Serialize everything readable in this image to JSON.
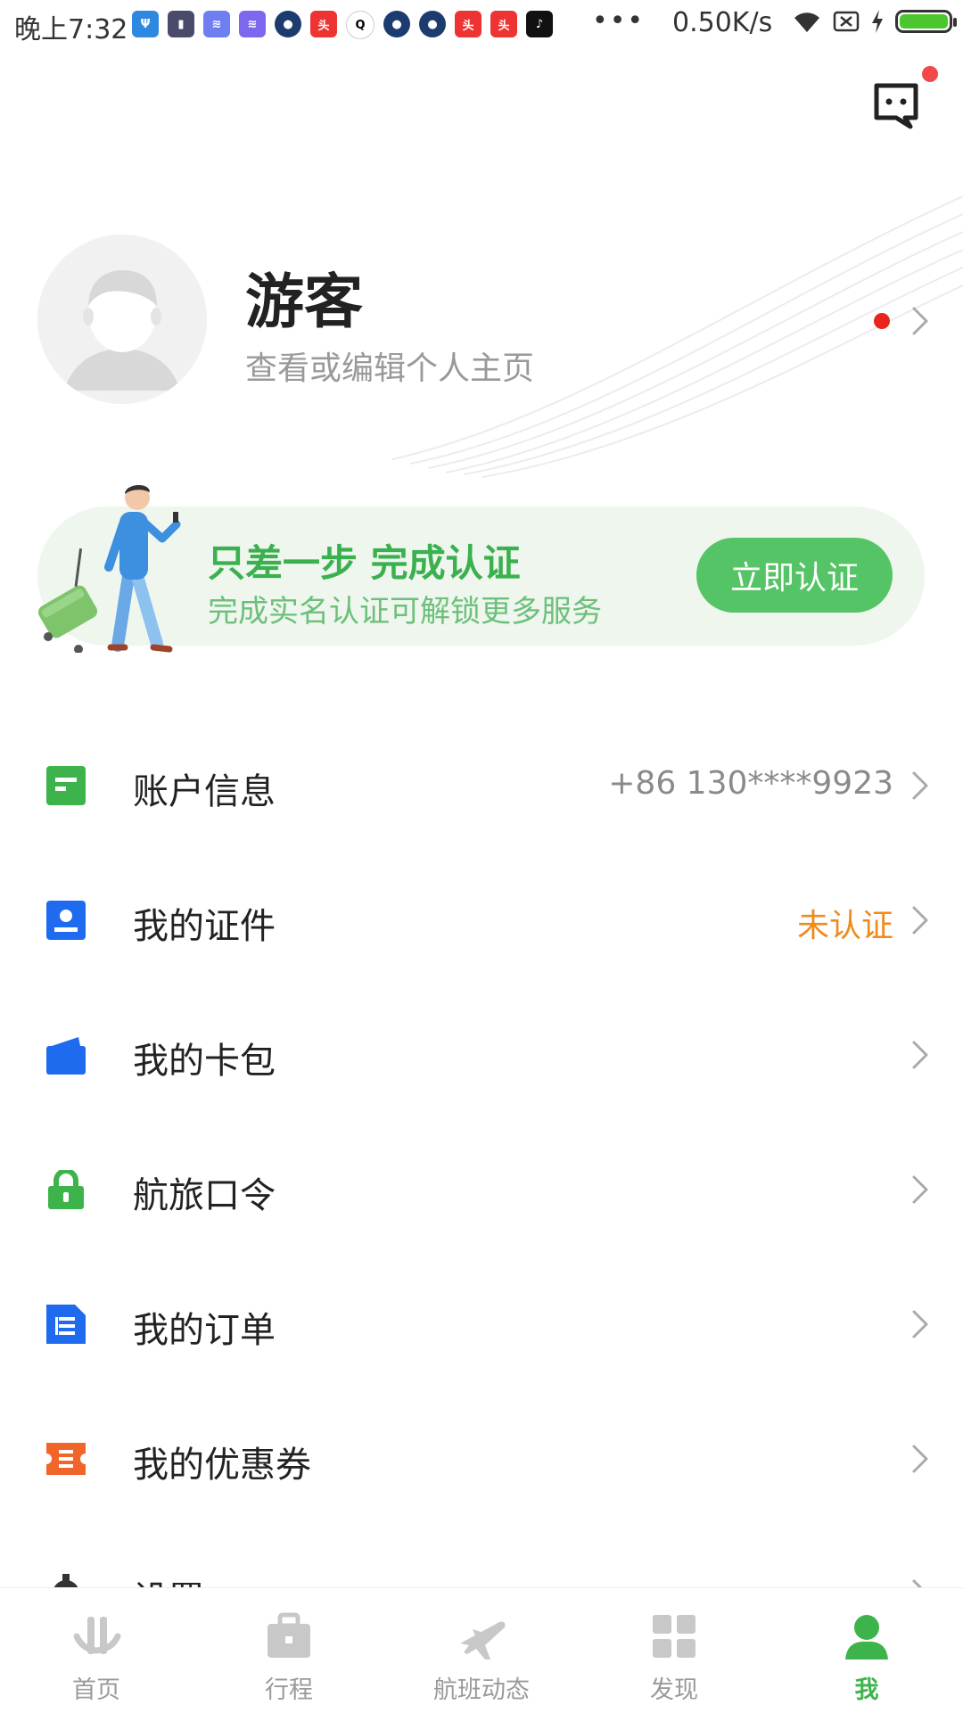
{
  "status_bar": {
    "time": "晚上7:32",
    "notification_icons": [
      "usb-icon",
      "phone-app-icon",
      "feather-app-icon",
      "feather-app-icon",
      "airline-app-icon",
      "toutiao-app-icon",
      "qq-icon",
      "airline-app-icon",
      "airline-app-icon",
      "toutiao-app-icon",
      "toutiao-app-icon",
      "tiktok-icon"
    ],
    "overflow": "•••",
    "net_speed": "0.50K/s",
    "right_icons": [
      "wifi-icon",
      "sim-icon",
      "charging-icon",
      "battery-icon"
    ],
    "battery_level": 1.0
  },
  "header": {
    "message_icon": "message-icon",
    "has_unread": true
  },
  "profile": {
    "name": "游客",
    "subtitle": "查看或编辑个人主页"
  },
  "banner": {
    "title": "只差一步  完成认证",
    "subtitle": "完成实名认证可解锁更多服务",
    "button": "立即认证"
  },
  "menu": [
    {
      "label": "账户信息",
      "value": "+86 130****9923",
      "icon": "account-info-icon",
      "color": "#3cb44b"
    },
    {
      "label": "我的证件",
      "value": "未认证",
      "icon": "id-card-icon",
      "color": "#1e6bf0",
      "value_color": "#f08a1a"
    },
    {
      "label": "我的卡包",
      "value": "",
      "icon": "card-wallet-icon",
      "color": "#1e6bf0"
    },
    {
      "label": "航旅口令",
      "value": "",
      "icon": "lock-icon",
      "color": "#3cb44b"
    },
    {
      "label": "我的订单",
      "value": "",
      "icon": "order-icon",
      "color": "#1e6bf0"
    },
    {
      "label": "我的优惠券",
      "value": "",
      "icon": "coupon-icon",
      "color": "#f2652a"
    },
    {
      "label": "设置",
      "value": "",
      "icon": "gear-icon",
      "color": "#333333"
    }
  ],
  "bottom_nav": [
    {
      "label": "首页",
      "icon": "home-icon",
      "active": false
    },
    {
      "label": "行程",
      "icon": "briefcase-icon",
      "active": false
    },
    {
      "label": "航班动态",
      "icon": "plane-icon",
      "active": false
    },
    {
      "label": "发现",
      "icon": "grid-icon",
      "active": false
    },
    {
      "label": "我",
      "icon": "person-icon",
      "active": true
    }
  ],
  "colors": {
    "accent_green": "#3cb44b",
    "button_green": "#55c466",
    "warning_orange": "#f08a1a",
    "badge_red": "#f44848"
  }
}
